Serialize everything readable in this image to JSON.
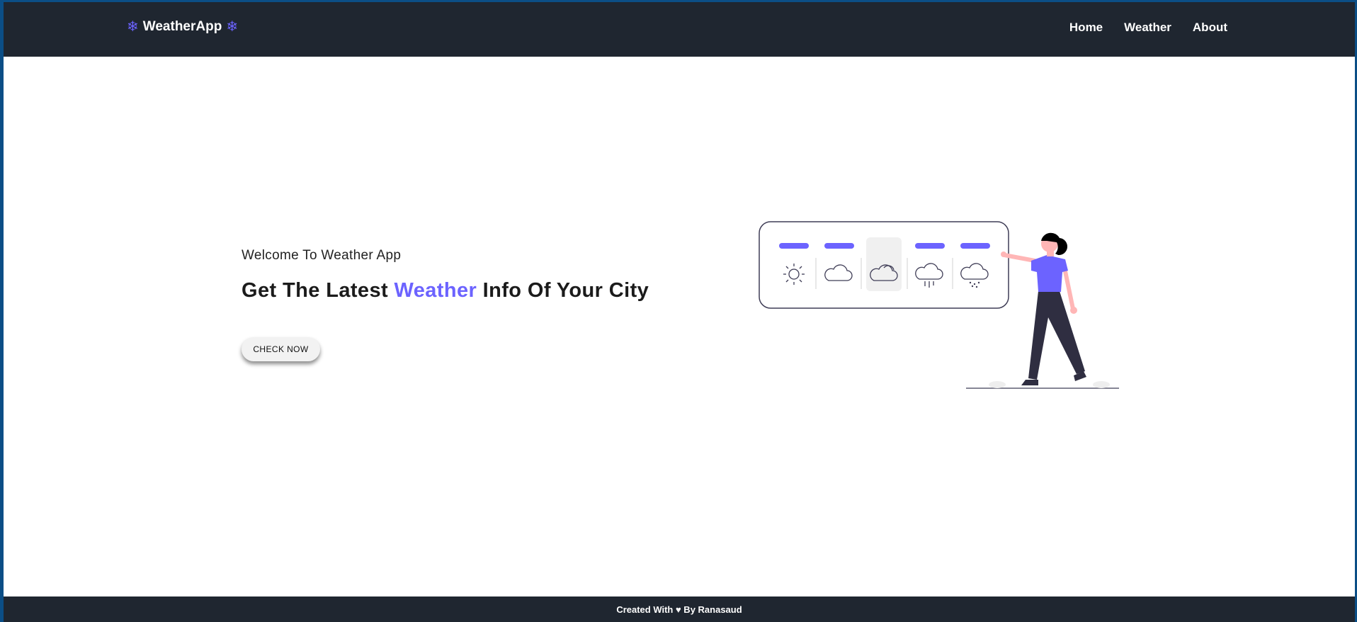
{
  "brand": {
    "name": "WeatherApp",
    "icon": "snowflake-icon",
    "icon_color": "#6c63ff"
  },
  "nav": {
    "items": [
      "Home",
      "Weather",
      "About"
    ]
  },
  "hero": {
    "welcome": "Welcome To Weather App",
    "headline_prefix": "Get The Latest ",
    "headline_accent": "Weather",
    "headline_suffix": " Info Of Your City",
    "cta_label": "CHECK NOW"
  },
  "illustration": {
    "icons": [
      "sun-icon",
      "cloud-icon",
      "cloud-icon",
      "rain-cloud-icon",
      "snow-cloud-icon"
    ],
    "selected_index": 2,
    "accent": "#6c63ff"
  },
  "footer": {
    "text": "Created With ♥ By Ranasaud"
  },
  "colors": {
    "nav_bg": "#1f2630",
    "accent": "#6c63ff"
  }
}
